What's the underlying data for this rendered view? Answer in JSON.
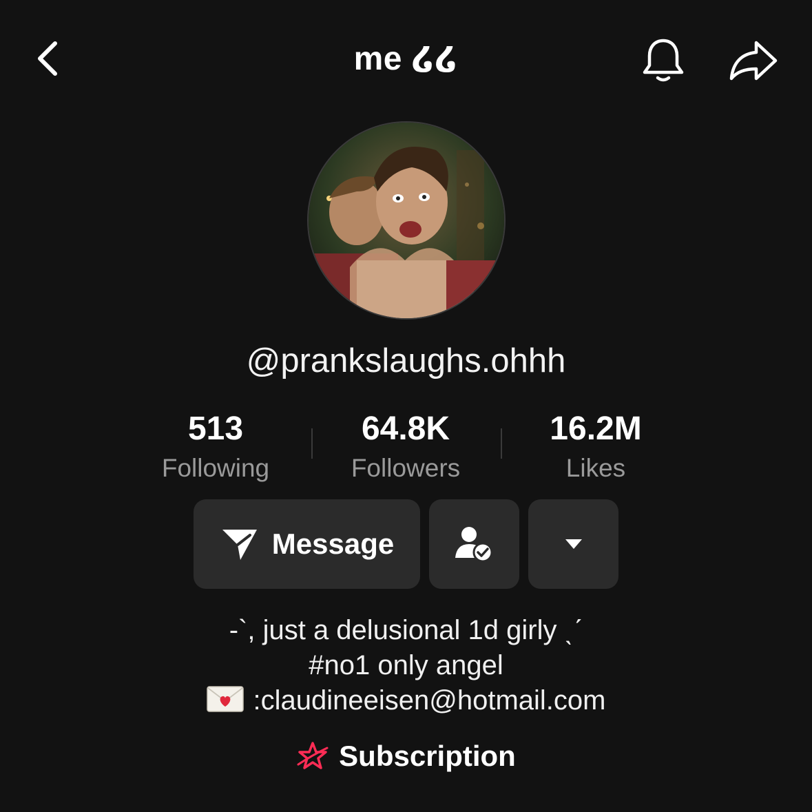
{
  "header": {
    "title": "me ໒໒",
    "back_icon": "chevron-left-icon",
    "bell_icon": "bell-icon",
    "share_icon": "share-arrow-icon"
  },
  "profile": {
    "username": "@prankslaughs.ohhh"
  },
  "stats": [
    {
      "value": "513",
      "label": "Following"
    },
    {
      "value": "64.8K",
      "label": "Followers"
    },
    {
      "value": "16.2M",
      "label": "Likes"
    }
  ],
  "actions": {
    "message_label": "Message",
    "message_icon": "send-icon",
    "friend_icon": "user-check-icon",
    "more_icon": "caret-down-icon"
  },
  "bio": {
    "line1": "-`, just a delusional 1d girly ˎˊ",
    "line2": "#no1 only angel",
    "line3": ":claudineeisen@hotmail.com",
    "line3_icon": "love-letter-icon"
  },
  "subscription": {
    "label": "Subscription",
    "icon": "star-subscription-icon",
    "icon_color": "#fe2c55"
  },
  "colors": {
    "background": "#121212",
    "button": "#2b2b2b",
    "muted_text": "#9a9a9a",
    "accent": "#fe2c55"
  }
}
